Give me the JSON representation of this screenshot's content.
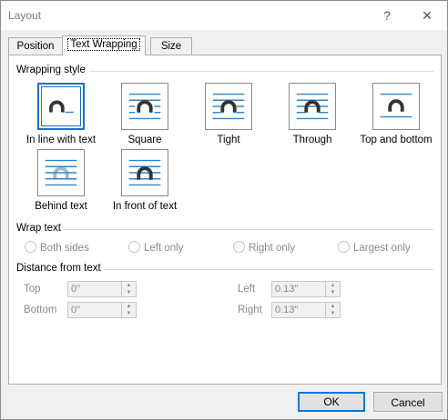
{
  "window": {
    "title": "Layout",
    "help_glyph": "?",
    "close_glyph": "✕"
  },
  "tabs": [
    {
      "label": "Position",
      "active": false
    },
    {
      "label": "Text Wrapping",
      "active": true
    },
    {
      "label": "Size",
      "active": false
    }
  ],
  "wrapping_style": {
    "heading": "Wrapping style",
    "options": [
      {
        "label": "In line with text",
        "icon": "inline-wrap-icon",
        "selected": true
      },
      {
        "label": "Square",
        "icon": "square-wrap-icon",
        "selected": false
      },
      {
        "label": "Tight",
        "icon": "tight-wrap-icon",
        "selected": false
      },
      {
        "label": "Through",
        "icon": "through-wrap-icon",
        "selected": false
      },
      {
        "label": "Top and bottom",
        "icon": "top-bottom-wrap-icon",
        "selected": false
      },
      {
        "label": "Behind text",
        "icon": "behind-text-icon",
        "selected": false
      },
      {
        "label": "In front of text",
        "icon": "in-front-text-icon",
        "selected": false
      }
    ]
  },
  "wrap_text": {
    "heading": "Wrap text",
    "options": [
      "Both sides",
      "Left only",
      "Right only",
      "Largest only"
    ]
  },
  "distance": {
    "heading": "Distance from text",
    "top": {
      "label": "Top",
      "value": "0\""
    },
    "bottom": {
      "label": "Bottom",
      "value": "0\""
    },
    "left": {
      "label": "Left",
      "value": "0.13\""
    },
    "right": {
      "label": "Right",
      "value": "0.13\""
    }
  },
  "buttons": {
    "ok": "OK",
    "cancel": "Cancel"
  },
  "colors": {
    "accent": "#1f6fbf",
    "line": "#2e86c8",
    "shape": "#333333",
    "disabled": "#8a8a8a"
  }
}
